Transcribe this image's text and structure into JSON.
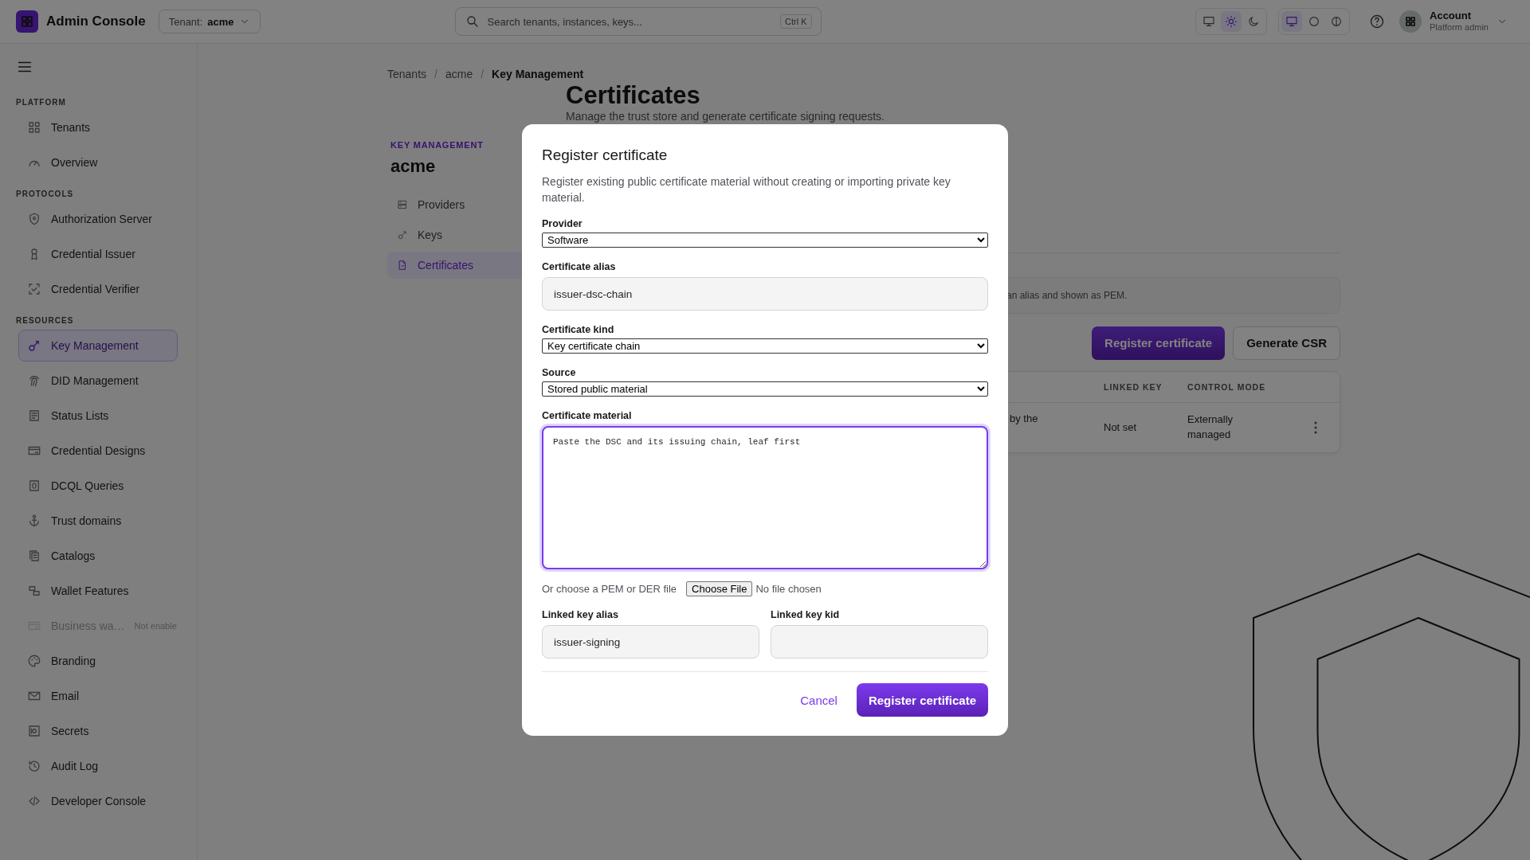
{
  "app": {
    "title": "Admin Console",
    "tenant_label": "Tenant:",
    "tenant": "acme"
  },
  "search": {
    "placeholder": "Search tenants, instances, keys...",
    "shortcut": "Ctrl K"
  },
  "toolbar_groups": [
    {
      "buttons": [
        {
          "selected": false
        },
        {
          "selected": true
        },
        {
          "selected": false
        }
      ]
    },
    {
      "buttons": [
        {
          "selected": true
        },
        {
          "selected": false
        },
        {
          "selected": false
        }
      ]
    }
  ],
  "account": {
    "name": "Account",
    "role": "Platform admin"
  },
  "sidebar": {
    "sections": [
      {
        "title": "PLATFORM",
        "items": [
          {
            "label": "Tenants",
            "selected": false,
            "disabled": false
          },
          {
            "label": "Overview",
            "selected": false,
            "disabled": false
          }
        ]
      },
      {
        "title": "PROTOCOLS",
        "items": [
          {
            "label": "Authorization Server",
            "selected": false,
            "disabled": false
          },
          {
            "label": "Credential Issuer",
            "selected": false,
            "disabled": false
          },
          {
            "label": "Credential Verifier",
            "selected": false,
            "disabled": false
          }
        ]
      },
      {
        "title": "RESOURCES",
        "items": [
          {
            "label": "Key Management",
            "selected": true,
            "disabled": false
          },
          {
            "label": "DID Management",
            "selected": false,
            "disabled": false
          },
          {
            "label": "Status Lists",
            "selected": false,
            "disabled": false
          },
          {
            "label": "Credential Designs",
            "selected": false,
            "disabled": false
          },
          {
            "label": "DCQL Queries",
            "selected": false,
            "disabled": false
          },
          {
            "label": "Trust domains",
            "selected": false,
            "disabled": false
          },
          {
            "label": "Catalogs",
            "selected": false,
            "disabled": false
          },
          {
            "label": "Wallet Features",
            "selected": false,
            "disabled": false
          },
          {
            "label": "Business wa…",
            "badge": "Not enable",
            "selected": false,
            "disabled": true
          },
          {
            "label": "Branding",
            "selected": false,
            "disabled": false
          },
          {
            "label": "Email",
            "selected": false,
            "disabled": false
          },
          {
            "label": "Secrets",
            "selected": false,
            "disabled": false
          },
          {
            "label": "Audit Log",
            "selected": false,
            "disabled": false
          },
          {
            "label": "Developer Console",
            "selected": false,
            "disabled": false
          }
        ]
      }
    ]
  },
  "breadcrumb": {
    "items": [
      "Tenants",
      "acme",
      "Key Management"
    ],
    "separator": "/"
  },
  "section_nav": {
    "eyebrow": "KEY MANAGEMENT",
    "title": "acme",
    "items": [
      {
        "label": "Providers",
        "selected": false
      },
      {
        "label": "Keys",
        "selected": false
      },
      {
        "label": "Certificates",
        "selected": true
      }
    ]
  },
  "page": {
    "title": "Certificates",
    "subtitle": "Manage the trust store and generate certificate signing requests.",
    "info": "an alias and shown as PEM.",
    "actions": [
      "Register certificate",
      "Generate CSR"
    ],
    "table": {
      "columns": [
        "",
        "LINKED KEY",
        "CONTROL MODE"
      ],
      "rows": [
        {
          "cells": [
            "by the",
            "Not set",
            "Externally managed"
          ]
        }
      ]
    }
  },
  "modal": {
    "title": "Register certificate",
    "description": "Register existing public certificate material without creating or importing private key material.",
    "fields": [
      {
        "kind": "select",
        "label": "Provider",
        "value": "Software",
        "focused": false
      },
      {
        "kind": "input",
        "label": "Certificate alias",
        "value": "issuer-dsc-chain",
        "focused": false
      },
      {
        "kind": "select",
        "label": "Certificate kind",
        "value": "Key certificate chain",
        "focused": false
      },
      {
        "kind": "select",
        "label": "Source",
        "value": "Stored public material",
        "focused": false
      },
      {
        "kind": "textarea",
        "label": "Certificate material",
        "placeholder": "Paste the DSC and its issuing chain, leaf first",
        "focused": true
      }
    ],
    "file": {
      "label": "Or choose a PEM or DER file",
      "button": "Choose File",
      "status": "No file chosen"
    },
    "linked": [
      {
        "label": "Linked key alias",
        "value": "issuer-signing"
      },
      {
        "label": "Linked key kid"
      }
    ],
    "cancel": "Cancel",
    "submit": "Register certificate"
  }
}
